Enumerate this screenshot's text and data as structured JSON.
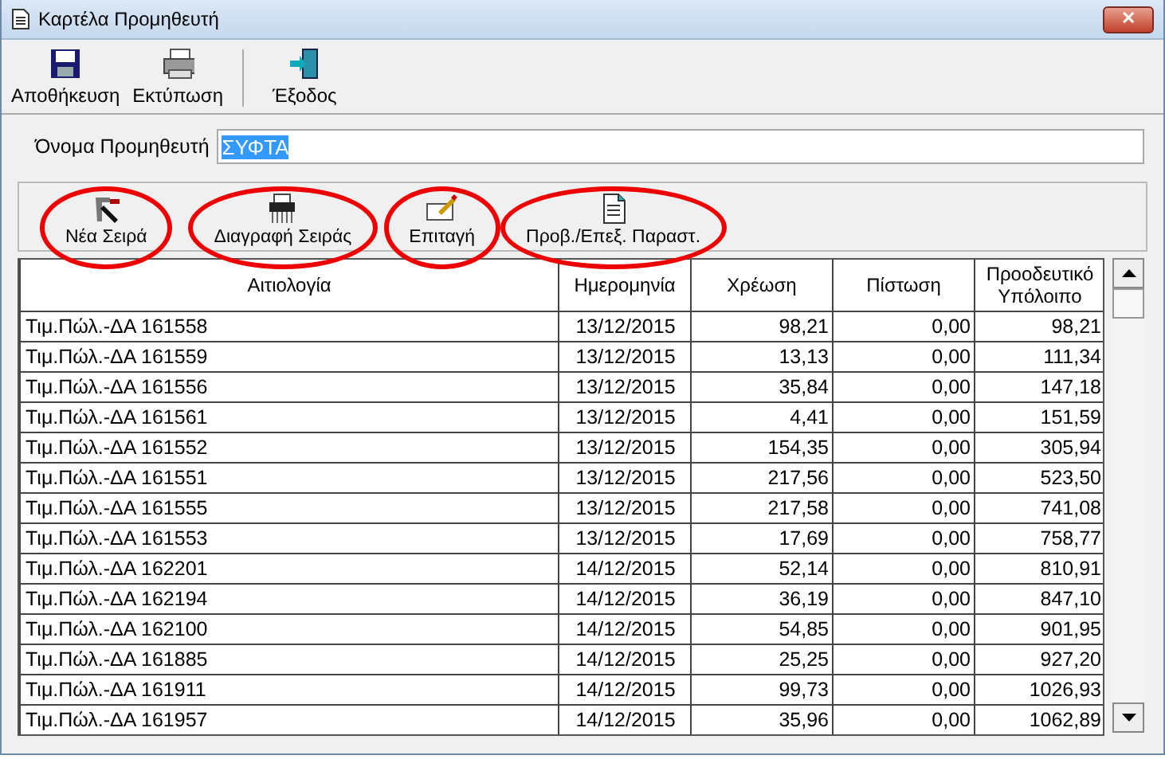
{
  "window": {
    "title": "Καρτέλα Προμηθευτή",
    "close": "✕"
  },
  "toolbar": [
    {
      "label": "Αποθήκευση"
    },
    {
      "label": "Εκτύπωση"
    },
    {
      "label": "Έξοδος",
      "separator_before": true
    }
  ],
  "supplier": {
    "label": "Όνομα Προμηθευτή",
    "value": "ΣΥΦΤΑ"
  },
  "row_actions": [
    {
      "label": "Νέα Σειρά",
      "highlighted": true
    },
    {
      "label": "Διαγραφή Σειράς",
      "highlighted": true
    },
    {
      "label": "Επιταγή",
      "highlighted": true
    },
    {
      "label": "Προβ./Επεξ. Παραστ.",
      "highlighted": true
    }
  ],
  "table": {
    "columns": [
      "Αιτιολογία",
      "Ημερομηνία",
      "Χρέωση",
      "Πίστωση",
      "Προοδευτικό Υπόλοιπο"
    ],
    "rows": [
      [
        "Τιμ.Πώλ.-ΔΑ 161558",
        "13/12/2015",
        "98,21",
        "0,00",
        "98,21"
      ],
      [
        "Τιμ.Πώλ.-ΔΑ 161559",
        "13/12/2015",
        "13,13",
        "0,00",
        "111,34"
      ],
      [
        "Τιμ.Πώλ.-ΔΑ 161556",
        "13/12/2015",
        "35,84",
        "0,00",
        "147,18"
      ],
      [
        "Τιμ.Πώλ.-ΔΑ 161561",
        "13/12/2015",
        "4,41",
        "0,00",
        "151,59"
      ],
      [
        "Τιμ.Πώλ.-ΔΑ 161552",
        "13/12/2015",
        "154,35",
        "0,00",
        "305,94"
      ],
      [
        "Τιμ.Πώλ.-ΔΑ 161551",
        "13/12/2015",
        "217,56",
        "0,00",
        "523,50"
      ],
      [
        "Τιμ.Πώλ.-ΔΑ 161555",
        "13/12/2015",
        "217,58",
        "0,00",
        "741,08"
      ],
      [
        "Τιμ.Πώλ.-ΔΑ 161553",
        "13/12/2015",
        "17,69",
        "0,00",
        "758,77"
      ],
      [
        "Τιμ.Πώλ.-ΔΑ 162201",
        "14/12/2015",
        "52,14",
        "0,00",
        "810,91"
      ],
      [
        "Τιμ.Πώλ.-ΔΑ 162194",
        "14/12/2015",
        "36,19",
        "0,00",
        "847,10"
      ],
      [
        "Τιμ.Πώλ.-ΔΑ 162100",
        "14/12/2015",
        "54,85",
        "0,00",
        "901,95"
      ],
      [
        "Τιμ.Πώλ.-ΔΑ 161885",
        "14/12/2015",
        "25,25",
        "0,00",
        "927,20"
      ],
      [
        "Τιμ.Πώλ.-ΔΑ 161911",
        "14/12/2015",
        "99,73",
        "0,00",
        "1026,93"
      ],
      [
        "Τιμ.Πώλ.-ΔΑ 161957",
        "14/12/2015",
        "35,96",
        "0,00",
        "1062,89"
      ]
    ]
  }
}
